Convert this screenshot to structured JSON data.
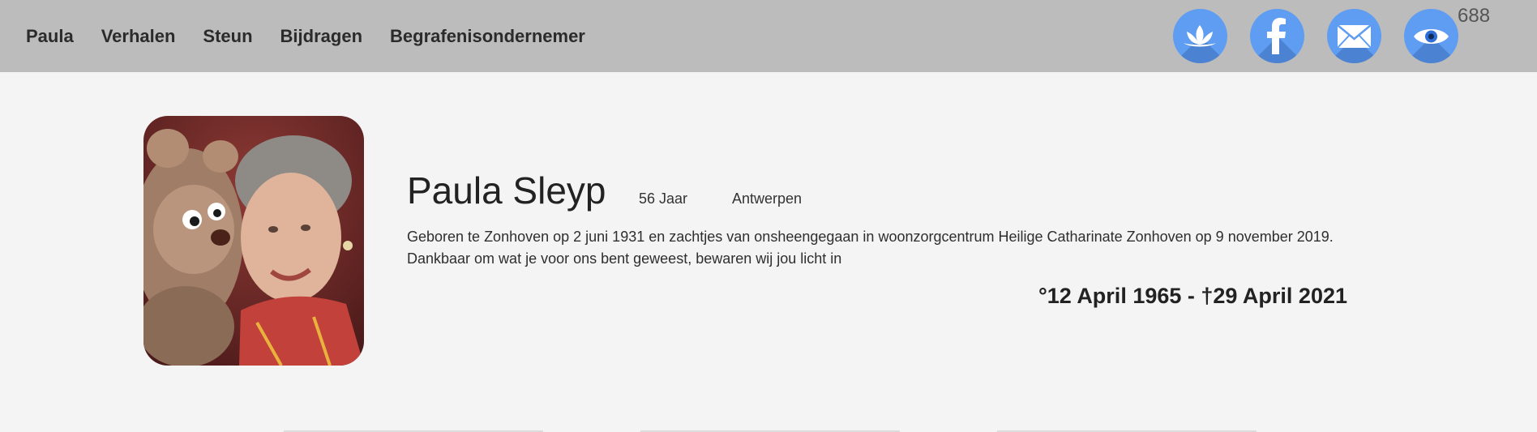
{
  "nav": {
    "items": [
      {
        "label": "Paula"
      },
      {
        "label": "Verhalen"
      },
      {
        "label": "Steun"
      },
      {
        "label": "Bijdragen"
      },
      {
        "label": "Begrafenisondernemer"
      }
    ]
  },
  "social": {
    "icons": [
      "lotus-icon",
      "facebook-icon",
      "mail-icon",
      "eye-icon"
    ],
    "accent": "#5e9df2"
  },
  "counter": "688",
  "profile": {
    "name": "Paula Sleyp",
    "age": "56 Jaar",
    "city": "Antwerpen",
    "bio": "Geboren te Zonhoven op 2 juni 1931 en zachtjes van onsheengegaan in woonzorgcentrum Heilige Catharinate Zonhoven op 9 november 2019. Dankbaar om wat je voor ons bent geweest, bewaren wij jou licht in",
    "dates": "°12 April 1965 - †29 April 2021"
  },
  "colors": {
    "topbar": "#bcbcbc",
    "background": "#f4f4f4"
  }
}
